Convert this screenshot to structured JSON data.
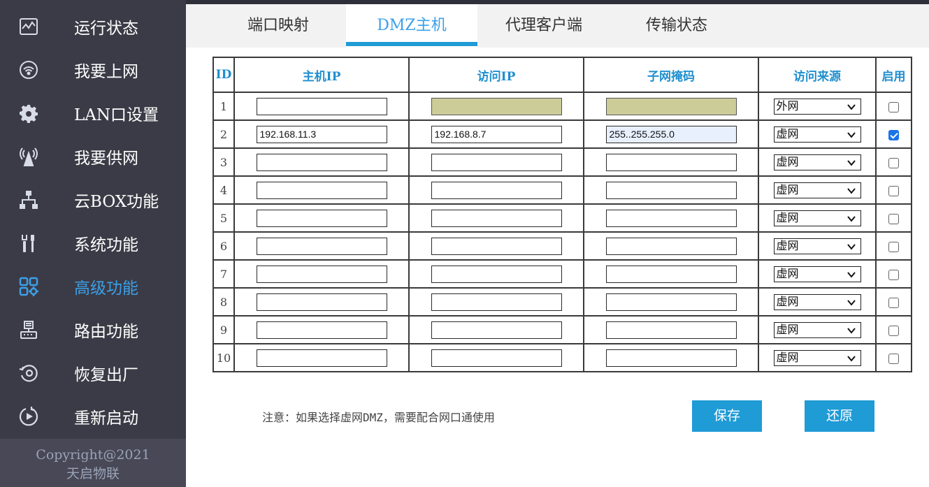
{
  "sidebar": {
    "items": [
      {
        "label": "运行状态",
        "icon": "status-chart-icon"
      },
      {
        "label": "我要上网",
        "icon": "wifi-icon"
      },
      {
        "label": "LAN口设置",
        "icon": "gear-icon"
      },
      {
        "label": "我要供网",
        "icon": "antenna-icon"
      },
      {
        "label": "云BOX功能",
        "icon": "network-tree-icon"
      },
      {
        "label": "系统功能",
        "icon": "tools-icon"
      },
      {
        "label": "高级功能",
        "icon": "apps-grid-icon"
      },
      {
        "label": "路由功能",
        "icon": "router-icon"
      },
      {
        "label": "恢复出厂",
        "icon": "restore-icon"
      },
      {
        "label": "重新启动",
        "icon": "restart-icon"
      }
    ],
    "active_index": 6,
    "copyright_line1": "Copyright@2021",
    "copyright_line2": "天启物联"
  },
  "tabs": [
    {
      "label": "端口映射"
    },
    {
      "label": "DMZ主机"
    },
    {
      "label": "代理客户端"
    },
    {
      "label": "传输状态"
    }
  ],
  "active_tab": 1,
  "table": {
    "headers": {
      "id": "ID",
      "host_ip": "主机IP",
      "access_ip": "访问IP",
      "subnet_mask": "子网掩码",
      "access_source": "访问来源",
      "enabled": "启用"
    },
    "rows": [
      {
        "id": "1",
        "host_ip": "",
        "access_ip": "",
        "subnet_mask": "",
        "source": "外网",
        "enabled": false
      },
      {
        "id": "2",
        "host_ip": "192.168.11.3",
        "access_ip": "192.168.8.7",
        "subnet_mask": "255..255.255.0",
        "source": "虚网",
        "enabled": true
      },
      {
        "id": "3",
        "host_ip": "",
        "access_ip": "",
        "subnet_mask": "",
        "source": "虚网",
        "enabled": false
      },
      {
        "id": "4",
        "host_ip": "",
        "access_ip": "",
        "subnet_mask": "",
        "source": "虚网",
        "enabled": false
      },
      {
        "id": "5",
        "host_ip": "",
        "access_ip": "",
        "subnet_mask": "",
        "source": "虚网",
        "enabled": false
      },
      {
        "id": "6",
        "host_ip": "",
        "access_ip": "",
        "subnet_mask": "",
        "source": "虚网",
        "enabled": false
      },
      {
        "id": "7",
        "host_ip": "",
        "access_ip": "",
        "subnet_mask": "",
        "source": "虚网",
        "enabled": false
      },
      {
        "id": "8",
        "host_ip": "",
        "access_ip": "",
        "subnet_mask": "",
        "source": "虚网",
        "enabled": false
      },
      {
        "id": "9",
        "host_ip": "",
        "access_ip": "",
        "subnet_mask": "",
        "source": "虚网",
        "enabled": false
      },
      {
        "id": "10",
        "host_ip": "",
        "access_ip": "",
        "subnet_mask": "",
        "source": "虚网",
        "enabled": false
      }
    ]
  },
  "note": "注意：如果选择虚网DMZ，需要配合网口通使用",
  "buttons": {
    "save": "保存",
    "restore": "还原"
  },
  "colors": {
    "sidebar_bg": "#3b3b47",
    "accent": "#1f9bd6",
    "active_text": "#3ba0e8",
    "disabled_input": "#cccc99"
  }
}
